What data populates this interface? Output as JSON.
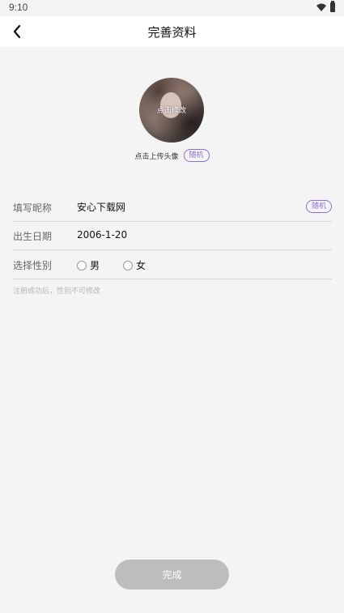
{
  "status_bar": {
    "time": "9:10",
    "wifi_icon": "wifi-icon",
    "battery_icon": "battery-icon"
  },
  "header": {
    "title": "完善资料",
    "back_icon": "chevron-left-icon"
  },
  "avatar": {
    "overlay_label": "点击修改",
    "upload_label": "点击上传头像",
    "random_label": "随机"
  },
  "form": {
    "nickname": {
      "label": "填写昵称",
      "value": "安心下载网",
      "random_label": "随机"
    },
    "birthday": {
      "label": "出生日期",
      "value": "2006-1-20"
    },
    "gender": {
      "label": "选择性别",
      "options": [
        "男",
        "女"
      ]
    },
    "note": "注册成功后，性别不可修改"
  },
  "footer": {
    "done_label": "完成"
  },
  "colors": {
    "accent": "#8c6fd0",
    "button_disabled": "#bdbdbd",
    "background": "#f4f4f4"
  }
}
